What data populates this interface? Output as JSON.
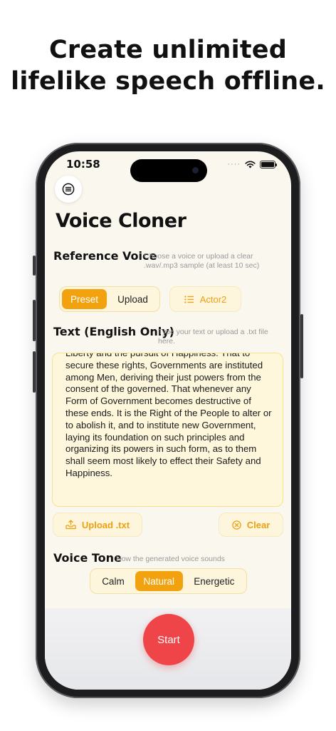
{
  "headline": {
    "line1": "Create unlimited",
    "line2": "lifelike speech offline."
  },
  "status_bar": {
    "time": "10:58",
    "signal_dots": "····"
  },
  "app": {
    "title": "Voice Cloner",
    "reference_voice": {
      "label": "Reference Voice",
      "hint": "Choose a voice or upload a clear .wav/.mp3 sample (at least 10 sec)",
      "source_options": [
        "Preset",
        "Upload"
      ],
      "selected_source": "Preset",
      "selected_voice": "Actor2",
      "voice_icon": "list-icon"
    },
    "text_input": {
      "label": "Text (English Only)",
      "hint": "Type your text or upload a .txt file here.",
      "value": "Liberty and the pursuit of Happiness. That to secure these rights, Governments are instituted among Men, deriving their just powers from the consent of the governed. That whenever any Form of Government becomes destructive of these ends. It is the Right of the People to alter or to abolish it, and to institute new Government, laying its foundation on such principles and organizing its powers in such form, as to them shall seem most likely to effect their Safety and Happiness.",
      "upload_label": "Upload .txt",
      "clear_label": "Clear"
    },
    "voice_tone": {
      "label": "Voice Tone",
      "hint": "How the generated voice sounds",
      "options": [
        "Calm",
        "Natural",
        "Energetic"
      ],
      "selected": "Natural"
    },
    "start_label": "Start"
  },
  "colors": {
    "accent": "#f3a20f",
    "accent_text": "#eea010",
    "start": "#ef4448",
    "screen_bg": "#faf7ef"
  }
}
